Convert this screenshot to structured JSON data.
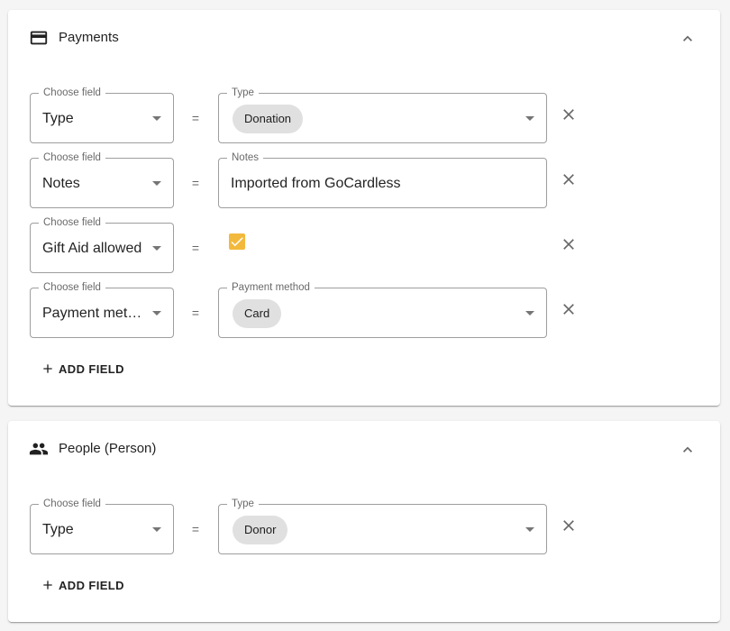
{
  "colors": {
    "checkbox_checked": "#f3b93c",
    "chip_background": "#e0e0e0"
  },
  "payments": {
    "title": "Payments",
    "icon": "credit-card-icon",
    "collapse_icon": "chevron-up-icon",
    "rows": [
      {
        "field_label": "Choose field",
        "field_value": "Type",
        "operator": "=",
        "value_label": "Type",
        "value_kind": "chip-select",
        "value": "Donation"
      },
      {
        "field_label": "Choose field",
        "field_value": "Notes",
        "operator": "=",
        "value_label": "Notes",
        "value_kind": "text",
        "value": "Imported from GoCardless"
      },
      {
        "field_label": "Choose field",
        "field_value": "Gift Aid allowed",
        "operator": "=",
        "value_kind": "checkbox",
        "checked": true
      },
      {
        "field_label": "Choose field",
        "field_value": "Payment method",
        "operator": "=",
        "value_label": "Payment method",
        "value_kind": "chip-select",
        "value": "Card"
      }
    ],
    "add_field_label": "ADD FIELD"
  },
  "people": {
    "title": "People (Person)",
    "icon": "people-icon",
    "collapse_icon": "chevron-up-icon",
    "rows": [
      {
        "field_label": "Choose field",
        "field_value": "Type",
        "operator": "=",
        "value_label": "Type",
        "value_kind": "chip-select",
        "value": "Donor"
      }
    ],
    "add_field_label": "ADD FIELD"
  }
}
